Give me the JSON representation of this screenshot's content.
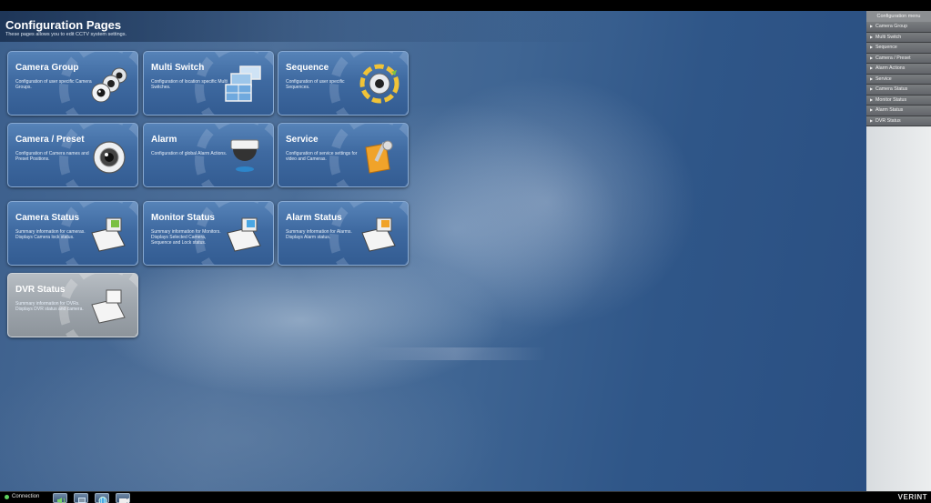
{
  "header": {
    "title": "Configuration Pages",
    "subtitle": "These pages allows you to edit CCTV system settings."
  },
  "tiles": [
    {
      "title": "Camera Group",
      "desc": "Configuration of user specific Camera Groups.",
      "icon": "camera-group-icon"
    },
    {
      "title": "Multi Switch",
      "desc": "Configuration of location specific Multi Switches.",
      "icon": "monitor-wall-icon"
    },
    {
      "title": "Sequence",
      "desc": "Configuration of user specific Sequences.",
      "icon": "sequence-icon"
    },
    {
      "title": "Camera / Preset",
      "desc": "Configuration of Camera names and Preset Positions.",
      "icon": "camera-lens-icon"
    },
    {
      "title": "Alarm",
      "desc": "Configuration of global Alarm Actions.",
      "icon": "dome-camera-icon"
    },
    {
      "title": "Service",
      "desc": "Configuration of service settings for video and Cameras.",
      "icon": "service-tools-icon"
    },
    {
      "title": "Camera Status",
      "desc": "Summary information for cameras. Displays Camera lock status.",
      "icon": "camera-status-icon"
    },
    {
      "title": "Monitor Status",
      "desc": "Summary information for Monitors. Displays Selected Camera, Sequence and Lock status.",
      "icon": "monitor-status-icon"
    },
    {
      "title": "Alarm Status",
      "desc": "Summary information for Alarms. Displays Alarm status.",
      "icon": "alarm-status-icon"
    },
    {
      "title": "DVR Status",
      "desc": "Summary information for DVRs. Displays DVR status and camera.",
      "icon": "dvr-status-icon"
    }
  ],
  "sidebar": {
    "header": "Configuration menu",
    "items": [
      {
        "label": "Camera Group"
      },
      {
        "label": "Multi Switch"
      },
      {
        "label": "Sequence"
      },
      {
        "label": "Camera / Preset"
      },
      {
        "label": "Alarm Actions"
      },
      {
        "label": "Service"
      },
      {
        "label": "Camera Status"
      },
      {
        "label": "Monitor Status"
      },
      {
        "label": "Alarm Status"
      },
      {
        "label": "DVR Status"
      }
    ]
  },
  "bottombar": {
    "connection_label": "Connection",
    "brand": "VERINT",
    "buttons": [
      "speaker-icon",
      "list-icon",
      "globe-icon",
      "camera-icon"
    ]
  },
  "colors": {
    "tile_blue": "#3f6aa1",
    "tile_gray": "#9ea5ac",
    "background": "#3c5f8c",
    "connection_ok": "#5fd25f"
  }
}
